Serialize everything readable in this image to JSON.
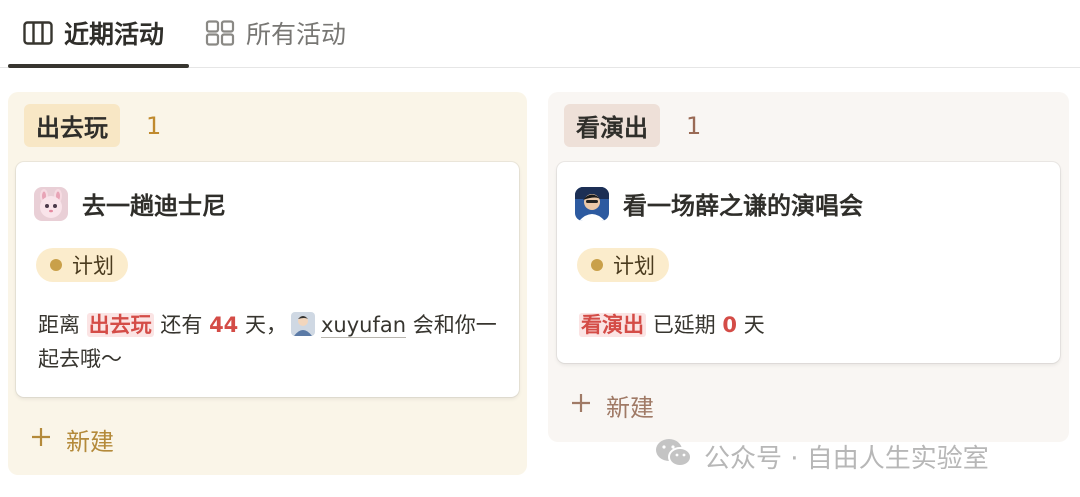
{
  "tabs": [
    {
      "label": "近期活动",
      "icon": "board-icon",
      "active": true
    },
    {
      "label": "所有活动",
      "icon": "gallery-icon",
      "active": false
    }
  ],
  "columns": [
    {
      "group": "出去玩",
      "count": "1",
      "cards": [
        {
          "title": "去一趟迪士尼",
          "icon": "plush-bunny-icon",
          "status": "计划",
          "text": {
            "pre": "距离",
            "group": "出去玩",
            "mid": "还有",
            "days": "44",
            "unit": "天，",
            "mention": "xuyufan",
            "post": "会和你一起去哦～"
          }
        }
      ],
      "new_label": "新建"
    },
    {
      "group": "看演出",
      "count": "1",
      "cards": [
        {
          "title": "看一场薛之谦的演唱会",
          "icon": "singer-avatar-icon",
          "status": "计划",
          "text": {
            "group": "看演出",
            "mid": "已延期",
            "days": "0",
            "unit": "天"
          }
        }
      ],
      "new_label": "新建"
    }
  ],
  "watermark": {
    "text": "公众号 · 自由人生实验室",
    "icon": "wechat-icon"
  },
  "colors": {
    "left_column_bg": "#faf5e8",
    "right_column_bg": "#f9f6f3",
    "highlight_red": "#d44c47",
    "status_pill_bg": "#fbeccc"
  }
}
